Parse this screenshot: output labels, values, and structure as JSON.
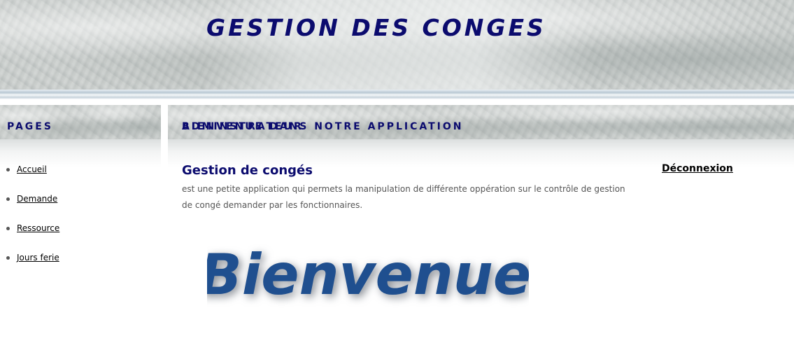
{
  "header": {
    "title": "GESTION DES CONGES"
  },
  "sidebar": {
    "title": "PAGES",
    "items": [
      {
        "label": "Accueil"
      },
      {
        "label": "Demande"
      },
      {
        "label": "Ressource"
      },
      {
        "label": "Jours ferie"
      }
    ]
  },
  "main": {
    "header": "BIENVENUE DANS NOTRE APPLICATION",
    "heading": "Gestion de congés",
    "text": "est une petite application qui permets la manipulation de différente oppération sur le contrôle de gestion de congé demander par les fonctionnaires.",
    "banner_text": "Bienvenue"
  },
  "admin": {
    "title": "ADMINSTRATEUR",
    "logout_label": "Déconnexion"
  },
  "colors": {
    "title_navy": "#0b0b6e",
    "banner_blue": "#1f4f8f",
    "body_text": "#555555"
  }
}
